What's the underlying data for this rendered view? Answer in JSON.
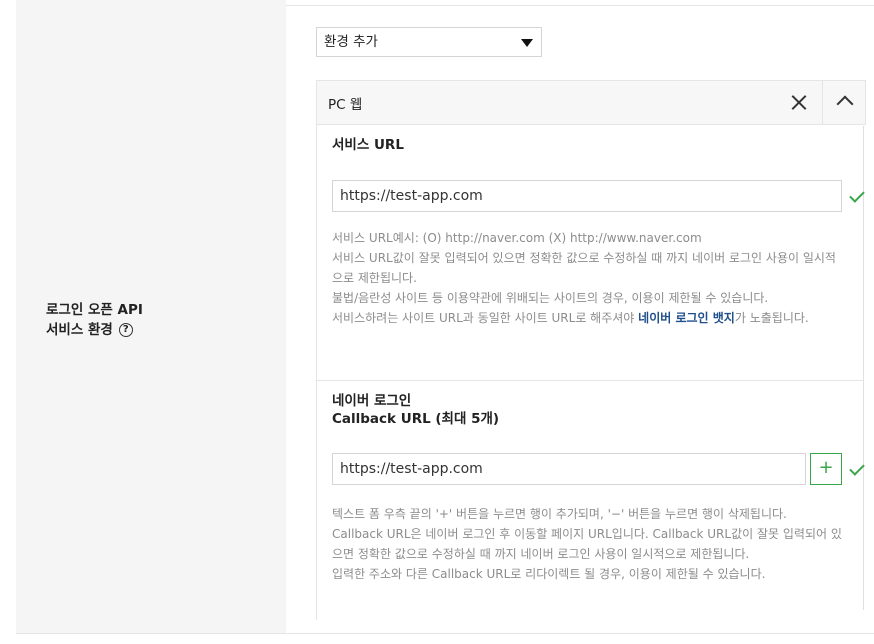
{
  "section": {
    "label_line1": "로그인 오픈 API",
    "label_line2": "서비스 환경",
    "help_symbol": "?"
  },
  "env_select": {
    "value": "환경 추가"
  },
  "panel": {
    "title": "PC 웹"
  },
  "service_url": {
    "label": "서비스 URL",
    "value": "https://test-app.com",
    "help": [
      "서비스 URL예시: (O) http://naver.com (X) http://www.naver.com",
      "서비스 URL값이 잘못 입력되어 있으면 정확한 값으로 수정하실 때 까지 네이버 로그인 사용이 일시적으로 제한됩니다.",
      "불법/음란성 사이트 등 이용약관에 위배되는 사이트의 경우, 이용이 제한될 수 있습니다."
    ],
    "badge_pre": "서비스하려는 사이트 URL과 동일한 사이트 URL로 해주셔야 ",
    "badge_strong": "네이버 로그인 뱃지",
    "badge_post": "가 노출됩니다."
  },
  "callback_url": {
    "label_line1": "네이버 로그인",
    "label_line2": "Callback URL (최대 5개)",
    "value": "https://test-app.com",
    "add_symbol": "+",
    "help": [
      "텍스트 폼 우측 끝의 '+' 버튼을 누르면 행이 추가되며, '−' 버튼을 누르면 행이 삭제됩니다.",
      "Callback URL은 네이버 로그인 후 이동할 페이지 URL입니다. Callback URL값이 잘못 입력되어 있으면 정확한 값으로 수정하실 때 까지 네이버 로그인 사용이 일시적으로 제한됩니다.",
      "입력한 주소와 다른 Callback URL로 리다이렉트 될 경우, 이용이 제한될 수 있습니다."
    ]
  },
  "colors": {
    "check": "#3aa54a",
    "link": "#1f4e8c"
  }
}
